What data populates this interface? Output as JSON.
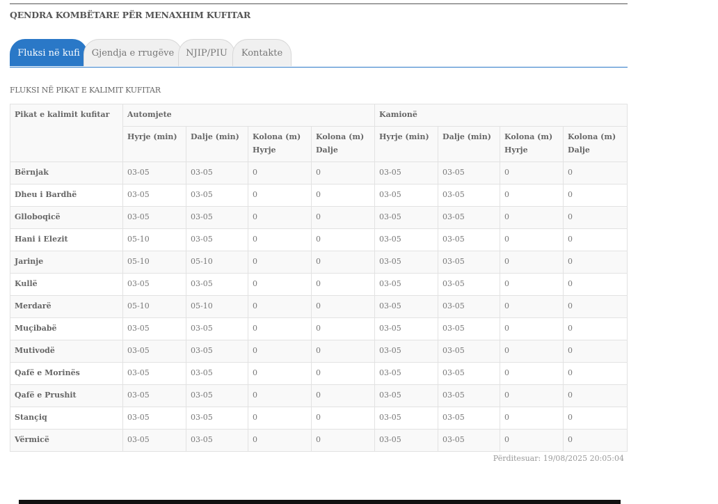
{
  "header": {
    "title": "QENDRA KOMBËTARE PËR MENAXHIM KUFITAR"
  },
  "tabs": [
    {
      "label": "Fluksi në kufi",
      "active": true
    },
    {
      "label": "Gjendja e rrugëve",
      "active": false
    },
    {
      "label": "NJIP/PIU",
      "active": false
    },
    {
      "label": "Kontakte",
      "active": false
    }
  ],
  "section": {
    "title": "FLUKSI NË PIKAT E KALIMIT KUFITAR"
  },
  "table": {
    "header_first": "Pikat e kalimit kufitar",
    "group_vehicles": "Automjete",
    "group_trucks": "Kamionë",
    "sub": {
      "in": "Hyrje (min)",
      "out": "Dalje (min)",
      "queue_in": "Kolona (m) Hyrje",
      "queue_out": "Kolona (m) Dalje"
    },
    "rows": [
      {
        "name": "Bërnjak",
        "v": [
          "03-05",
          "03-05",
          "0",
          "0",
          "03-05",
          "03-05",
          "0",
          "0"
        ]
      },
      {
        "name": "Dheu i Bardhë",
        "v": [
          "03-05",
          "03-05",
          "0",
          "0",
          "03-05",
          "03-05",
          "0",
          "0"
        ]
      },
      {
        "name": "Glloboqicë",
        "v": [
          "03-05",
          "03-05",
          "0",
          "0",
          "03-05",
          "03-05",
          "0",
          "0"
        ]
      },
      {
        "name": "Hani i Elezit",
        "v": [
          "05-10",
          "03-05",
          "0",
          "0",
          "03-05",
          "03-05",
          "0",
          "0"
        ]
      },
      {
        "name": "Jarinje",
        "v": [
          "05-10",
          "05-10",
          "0",
          "0",
          "03-05",
          "03-05",
          "0",
          "0"
        ]
      },
      {
        "name": "Kullë",
        "v": [
          "03-05",
          "03-05",
          "0",
          "0",
          "03-05",
          "03-05",
          "0",
          "0"
        ]
      },
      {
        "name": "Merdarë",
        "v": [
          "05-10",
          "05-10",
          "0",
          "0",
          "03-05",
          "03-05",
          "0",
          "0"
        ]
      },
      {
        "name": "Muçibabë",
        "v": [
          "03-05",
          "03-05",
          "0",
          "0",
          "03-05",
          "03-05",
          "0",
          "0"
        ]
      },
      {
        "name": "Mutivodë",
        "v": [
          "03-05",
          "03-05",
          "0",
          "0",
          "03-05",
          "03-05",
          "0",
          "0"
        ]
      },
      {
        "name": "Qafë e Morinës",
        "v": [
          "03-05",
          "03-05",
          "0",
          "0",
          "03-05",
          "03-05",
          "0",
          "0"
        ]
      },
      {
        "name": "Qafë e Prushit",
        "v": [
          "03-05",
          "03-05",
          "0",
          "0",
          "03-05",
          "03-05",
          "0",
          "0"
        ]
      },
      {
        "name": "Stançiq",
        "v": [
          "03-05",
          "03-05",
          "0",
          "0",
          "03-05",
          "03-05",
          "0",
          "0"
        ]
      },
      {
        "name": "Vërmicë",
        "v": [
          "03-05",
          "03-05",
          "0",
          "0",
          "03-05",
          "03-05",
          "0",
          "0"
        ]
      }
    ]
  },
  "footer": {
    "updated": "Përditesuar: 19/08/2025 20:05:04"
  },
  "colors": {
    "accent": "#2a78c7",
    "border": "#e2e2e2"
  }
}
